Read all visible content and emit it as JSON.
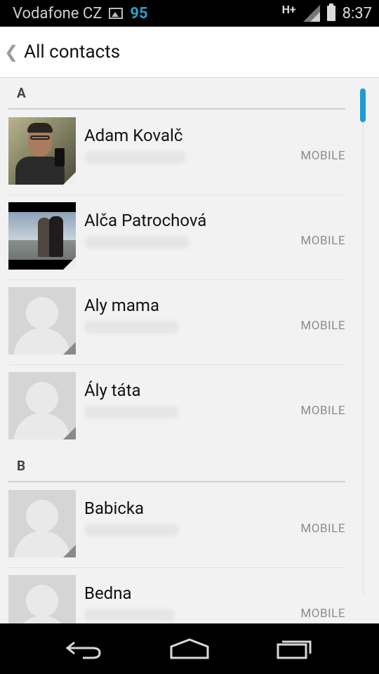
{
  "status_bar": {
    "carrier": "Vodafone CZ",
    "notification_count": "95",
    "network": "H+",
    "time": "8:37"
  },
  "action_bar": {
    "title": "All contacts"
  },
  "sections": [
    {
      "letter": "A"
    },
    {
      "letter": "B"
    }
  ],
  "contacts": [
    {
      "name": "Adam Kovalč",
      "phone_type": "MOBILE"
    },
    {
      "name": "Alča Patrochová",
      "phone_type": "MOBILE"
    },
    {
      "name": "Aly mama",
      "phone_type": "MOBILE"
    },
    {
      "name": "Ály táta",
      "phone_type": "MOBILE"
    },
    {
      "name": "Babicka",
      "phone_type": "MOBILE"
    },
    {
      "name": "Bedna",
      "phone_type": "MOBILE"
    }
  ],
  "colors": {
    "accent": "#1e9ad6",
    "notification_count": "#2ea0c8"
  },
  "icons": {
    "status": [
      "gallery-notification-icon",
      "signal-icon",
      "battery-icon"
    ],
    "nav": [
      "back-icon",
      "home-icon",
      "recent-apps-icon"
    ]
  }
}
